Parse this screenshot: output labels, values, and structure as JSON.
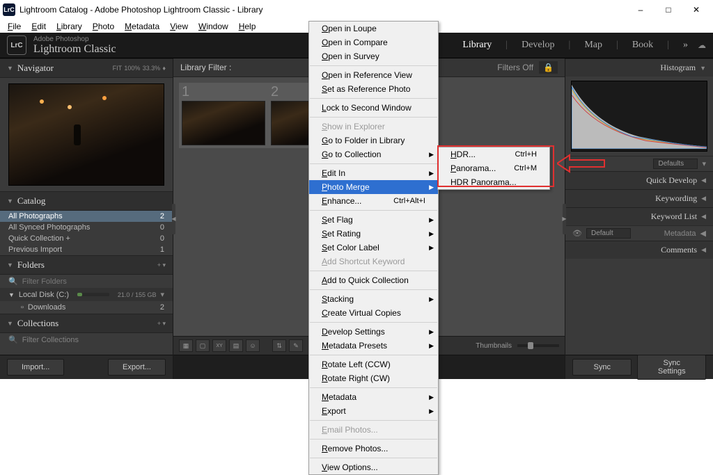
{
  "title": "Lightroom Catalog - Adobe Photoshop Lightroom Classic - Library",
  "app_icon": "LrC",
  "menubar": [
    "File",
    "Edit",
    "Library",
    "Photo",
    "Metadata",
    "View",
    "Window",
    "Help"
  ],
  "idbar": {
    "logo": "LrC",
    "brand_small": "Adobe Photoshop",
    "brand_big": "Lightroom Classic",
    "modules": [
      "Library",
      "Develop",
      "Map",
      "Book"
    ],
    "active_module": "Library",
    "more": "»"
  },
  "left": {
    "navigator": {
      "title": "Navigator",
      "fit": "FIT",
      "zoom1": "100%",
      "zoom2": "33.3%"
    },
    "catalog": {
      "title": "Catalog",
      "items": [
        {
          "label": "All Photographs",
          "count": "2",
          "selected": true
        },
        {
          "label": "All Synced Photographs",
          "count": "0"
        },
        {
          "label": "Quick Collection +",
          "count": "0"
        },
        {
          "label": "Previous Import",
          "count": "1"
        }
      ]
    },
    "folders": {
      "title": "Folders",
      "filter_label": "Filter Folders",
      "disk": "Local Disk (C:)",
      "disk_stat": "21.0 / 155 GB",
      "sub": "Downloads",
      "sub_count": "2"
    },
    "collections": {
      "title": "Collections",
      "filter_label": "Filter Collections"
    },
    "import_btn": "Import...",
    "export_btn": "Export..."
  },
  "center": {
    "filter_label": "Library Filter :",
    "filters_off": "Filters Off",
    "thumb1": "1",
    "thumb2": "2",
    "thumbnails_label": "Thumbnails"
  },
  "right": {
    "histogram": "Histogram",
    "defaults": "Defaults",
    "panels": [
      "Quick Develop",
      "Keywording",
      "Keyword List",
      "Metadata",
      "Comments"
    ],
    "meta_preset": "Default",
    "sync": "Sync",
    "sync_settings": "Sync Settings"
  },
  "ctx": {
    "items": [
      {
        "label": "Open in Loupe"
      },
      {
        "label": "Open in Compare"
      },
      {
        "label": "Open in Survey"
      },
      {
        "sep": true
      },
      {
        "label": "Open in Reference View"
      },
      {
        "label": "Set as Reference Photo"
      },
      {
        "sep": true
      },
      {
        "label": "Lock to Second Window"
      },
      {
        "sep": true
      },
      {
        "label": "Show in Explorer",
        "disabled": true
      },
      {
        "label": "Go to Folder in Library"
      },
      {
        "label": "Go to Collection",
        "sub": true
      },
      {
        "sep": true
      },
      {
        "label": "Edit In",
        "sub": true
      },
      {
        "label": "Photo Merge",
        "sub": true,
        "highlight": true
      },
      {
        "label": "Enhance...",
        "shortcut": "Ctrl+Alt+I"
      },
      {
        "sep": true
      },
      {
        "label": "Set Flag",
        "sub": true
      },
      {
        "label": "Set Rating",
        "sub": true
      },
      {
        "label": "Set Color Label",
        "sub": true
      },
      {
        "label": "Add Shortcut Keyword",
        "disabled": true
      },
      {
        "sep": true
      },
      {
        "label": "Add to Quick Collection"
      },
      {
        "sep": true
      },
      {
        "label": "Stacking",
        "sub": true
      },
      {
        "label": "Create Virtual Copies"
      },
      {
        "sep": true
      },
      {
        "label": "Develop Settings",
        "sub": true
      },
      {
        "label": "Metadata Presets",
        "sub": true
      },
      {
        "sep": true
      },
      {
        "label": "Rotate Left (CCW)"
      },
      {
        "label": "Rotate Right (CW)"
      },
      {
        "sep": true
      },
      {
        "label": "Metadata",
        "sub": true
      },
      {
        "label": "Export",
        "sub": true
      },
      {
        "sep": true
      },
      {
        "label": "Email Photos...",
        "disabled": true
      },
      {
        "sep": true
      },
      {
        "label": "Remove Photos..."
      },
      {
        "sep": true
      },
      {
        "label": "View Options..."
      }
    ],
    "sub": [
      {
        "label": "HDR...",
        "shortcut": "Ctrl+H"
      },
      {
        "label": "Panorama...",
        "shortcut": "Ctrl+M"
      },
      {
        "label": "HDR Panorama..."
      }
    ]
  }
}
